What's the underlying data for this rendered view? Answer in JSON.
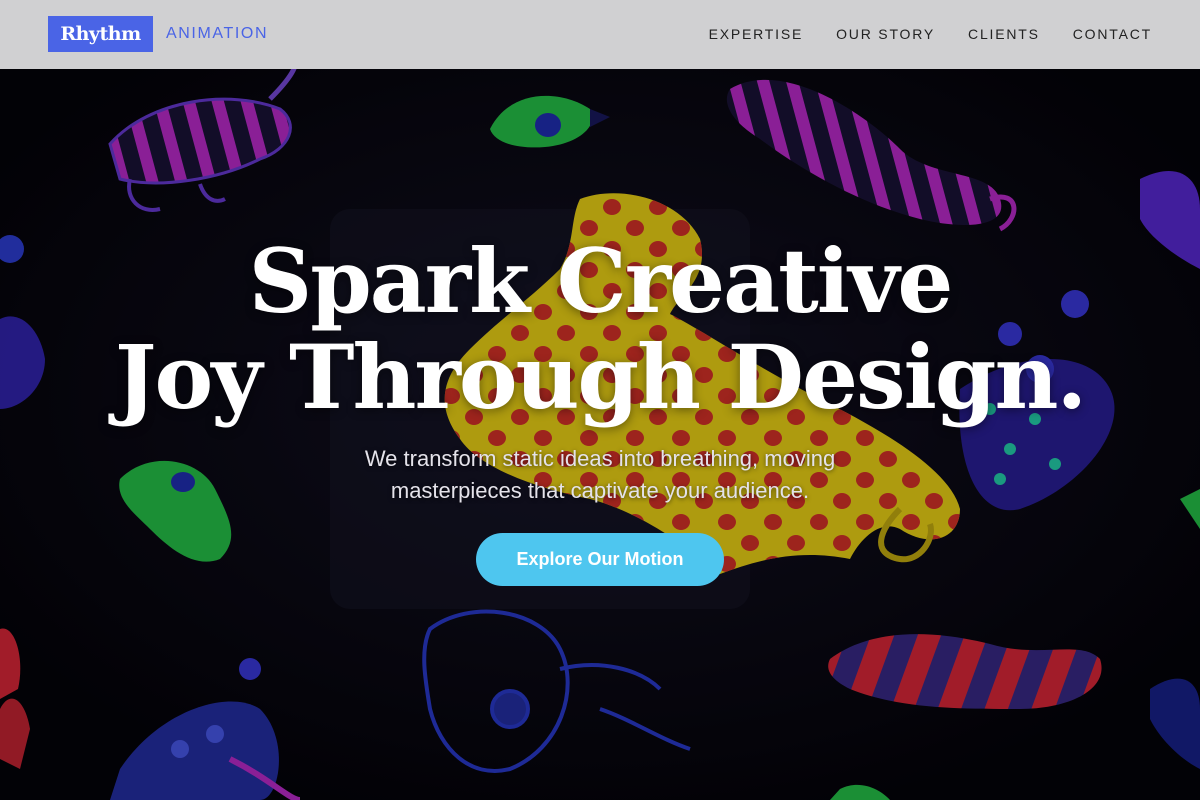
{
  "brand": {
    "logo": "Rhythm",
    "tagline": "ANIMATION",
    "accent": "#4a64e6"
  },
  "nav": {
    "links": [
      {
        "label": "EXPERTISE"
      },
      {
        "label": "OUR STORY"
      },
      {
        "label": "CLIENTS"
      },
      {
        "label": "CONTACT"
      }
    ]
  },
  "hero": {
    "headline_line1": "Spark Creative",
    "headline_line2": "Joy Through Design.",
    "subtitle_line1": "We transform static ideas into breathing, moving",
    "subtitle_line2": "masterpieces that captivate your audience.",
    "cta_label": "Explore Our Motion",
    "cta_color": "#4ec6ef",
    "background": "black-light puppet characters with a yellow polka-dot figure"
  }
}
